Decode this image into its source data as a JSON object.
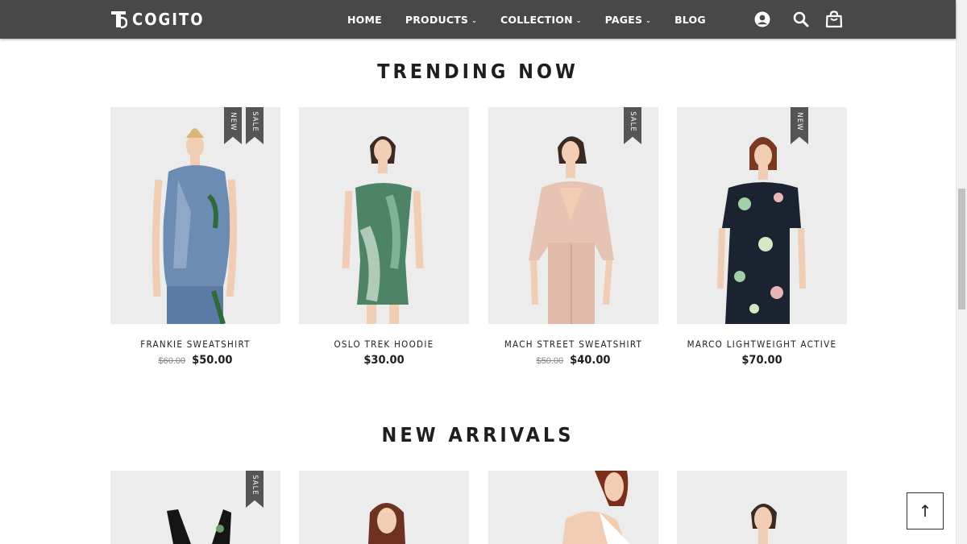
{
  "header": {
    "logo_text": "COGITO",
    "nav": [
      {
        "label": "HOME",
        "dropdown": false
      },
      {
        "label": "PRODUCTS",
        "dropdown": true
      },
      {
        "label": "COLLECTION",
        "dropdown": true
      },
      {
        "label": "PAGES",
        "dropdown": true
      },
      {
        "label": "BLOG",
        "dropdown": false
      }
    ],
    "icons": [
      "user-icon",
      "search-icon",
      "shopping-bag-icon"
    ],
    "background": "#484848"
  },
  "trending": {
    "title": "TRENDING NOW",
    "products": [
      {
        "name": "FRANKIE SWEATSHIRT",
        "old_price": "$60.00",
        "price": "$50.00",
        "badges": [
          "NEW",
          "SALE"
        ]
      },
      {
        "name": "OSLO TREK HOODIE",
        "old_price": "",
        "price": "$30.00",
        "badges": []
      },
      {
        "name": "MACH STREET SWEATSHIRT",
        "old_price": "$50.00",
        "price": "$40.00",
        "badges": [
          "SALE"
        ]
      },
      {
        "name": "MARCO LIGHTWEIGHT ACTIVE",
        "old_price": "",
        "price": "$70.00",
        "badges": [
          "NEW"
        ]
      }
    ]
  },
  "arrivals": {
    "title": "NEW ARRIVALS",
    "badges": [
      "SALE"
    ]
  },
  "back_to_top": "↑",
  "colors": {
    "ribbon": "#555555",
    "header": "#484848",
    "text": "#1e1e1e"
  }
}
